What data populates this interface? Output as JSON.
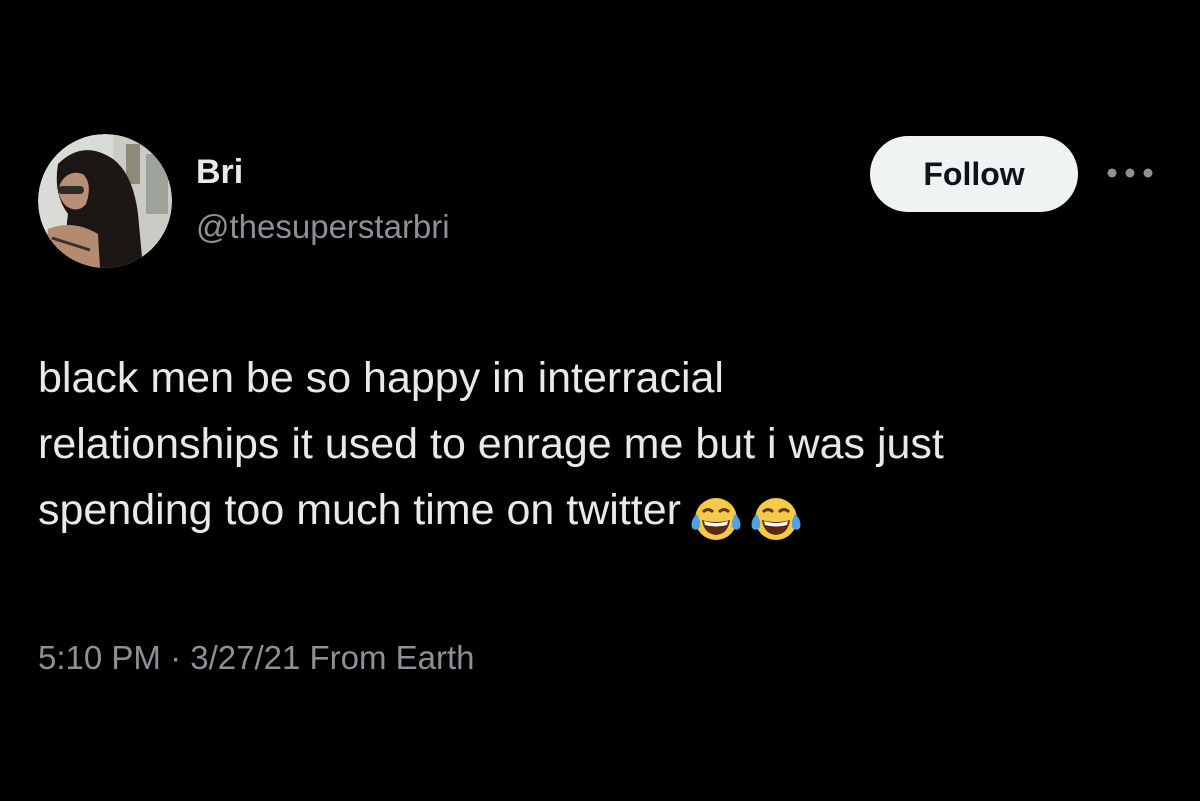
{
  "author": {
    "display_name": "Bri",
    "handle": "@thesuperstarbri"
  },
  "actions": {
    "follow_label": "Follow"
  },
  "tweet": {
    "text": "black men be so happy in interracial\nrelationships it used to enrage me but i was just\nspending too much time on twitter",
    "emojis": [
      "face-with-tears-of-joy-icon",
      "face-with-tears-of-joy-icon"
    ],
    "timestamp": "5:10 PM · 3/27/21 From Earth"
  },
  "colors": {
    "background": "#000000",
    "primary_text": "#e7e9ea",
    "secondary_text": "#8b9197",
    "follow_button_bg": "#eff3f4",
    "follow_button_text": "#0f1419"
  }
}
